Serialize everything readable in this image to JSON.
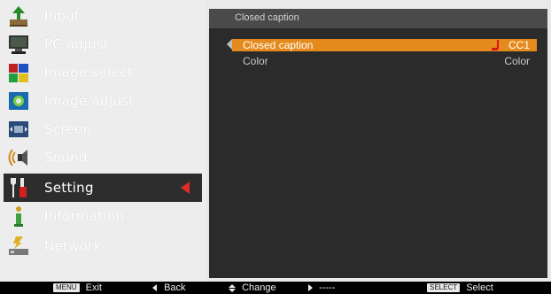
{
  "menu": {
    "items": [
      {
        "label": "Input",
        "icon": "input-icon"
      },
      {
        "label": "PC adjust",
        "icon": "pc-adjust-icon"
      },
      {
        "label": "Image select",
        "icon": "image-select-icon"
      },
      {
        "label": "Image adjust",
        "icon": "image-adjust-icon"
      },
      {
        "label": "Screen",
        "icon": "screen-icon"
      },
      {
        "label": "Sound",
        "icon": "sound-icon"
      },
      {
        "label": "Setting",
        "icon": "setting-icon",
        "selected": true
      },
      {
        "label": "Information",
        "icon": "information-icon"
      },
      {
        "label": "Network",
        "icon": "network-icon"
      }
    ]
  },
  "panel": {
    "title": "Closed caption",
    "rows": [
      {
        "label": "Closed caption",
        "value": "CC1",
        "active": true
      },
      {
        "label": "Color",
        "value": "Color",
        "active": false
      }
    ]
  },
  "footer": {
    "exit_key": "MENU",
    "exit_label": "Exit",
    "back_label": "Back",
    "change_label": "Change",
    "right_label": "-----",
    "select_key": "SELECT",
    "select_label": "Select"
  },
  "colors": {
    "accent": "#e58a1c",
    "selected_bg": "#2d2d2d",
    "panel_bg": "#2b2b2b",
    "arrow_red": "#e12a2a"
  }
}
